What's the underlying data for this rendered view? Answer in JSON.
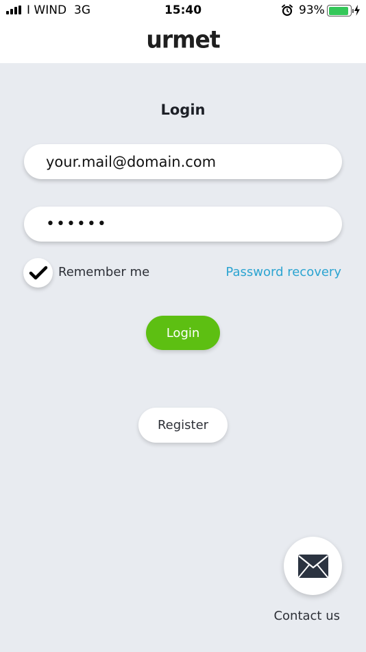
{
  "status_bar": {
    "carrier": "I WIND",
    "network": "3G",
    "time": "15:40",
    "battery_percent": "93%",
    "battery_level": 0.93
  },
  "header": {
    "logo": "urmet"
  },
  "login_form": {
    "title": "Login",
    "email_value": "your.mail@domain.com",
    "password_value": "••••••",
    "remember_label": "Remember me",
    "remember_checked": true,
    "recovery_label": "Password recovery",
    "login_button": "Login",
    "register_button": "Register"
  },
  "contact": {
    "label": "Contact us"
  },
  "colors": {
    "background": "#e8ebf0",
    "accent_green": "#5dbf12",
    "link_blue": "#2ba4d1"
  },
  "icons": [
    "signal-icon",
    "alarm-icon",
    "battery-icon",
    "charging-icon",
    "checkmark-icon",
    "mail-icon"
  ]
}
